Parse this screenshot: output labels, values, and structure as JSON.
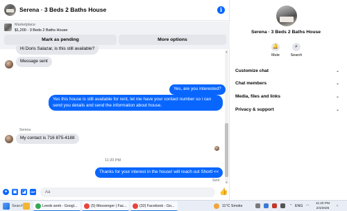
{
  "chat": {
    "title": "Serena · 3 Beds 2 Baths House",
    "info_icon": "info-icon",
    "marketplace": {
      "label": "Marketplace",
      "listing": "$1,200 · 3 Beds 2 Baths House",
      "pending_button": "Mark as pending",
      "more_button": "More options"
    },
    "messages": [
      {
        "direction": "in",
        "text": "Hi Doris Salazar, is this still available?"
      },
      {
        "direction": "in",
        "text": "Message sent"
      },
      {
        "direction": "out",
        "text": "Yes, are you interested?"
      },
      {
        "direction": "out",
        "lines": [
          "Yes this house is still available for rent, let me have your contact number so i can",
          "send you details and send the information about house."
        ]
      },
      {
        "direction": "in",
        "sender": "Serena",
        "text": "My contact is 716 875-4188"
      },
      {
        "direction": "out",
        "text": "Thanks for your interest in the house! will reach out Shortl <<"
      }
    ],
    "timestamp": "11:20 PM",
    "sent_label": "Sent",
    "composer": {
      "placeholder": "Aa",
      "icons": [
        "plus-icon",
        "photo-icon",
        "sticker-icon",
        "gif-icon"
      ],
      "like_icon": "thumbs-up-icon"
    }
  },
  "info": {
    "name": "Serena · 3 Beds 2 Baths House",
    "actions": [
      {
        "label": "Mute",
        "icon": "bell-icon"
      },
      {
        "label": "Search",
        "icon": "search-icon"
      }
    ],
    "sections": [
      "Customize chat",
      "Chat members",
      "Media, files and links",
      "Privacy & support"
    ]
  },
  "taskbar": {
    "search_label": "Search",
    "apps": [
      {
        "label": "Leeds work - Googl...",
        "color": "#34a853"
      },
      {
        "label": "(5) Messenger | Fac...",
        "color": "#e8453c"
      },
      {
        "label": "(32) Facebook - Go...",
        "color": "#e8453c"
      }
    ],
    "weather": "11°C  Smoke",
    "language": "ENG",
    "time": "11:20 PM",
    "date": "2/4/2025"
  },
  "colors": {
    "accent": "#0866ff",
    "bubble_in": "#e4e6eb",
    "panel_bg": "#f0f2f5"
  }
}
